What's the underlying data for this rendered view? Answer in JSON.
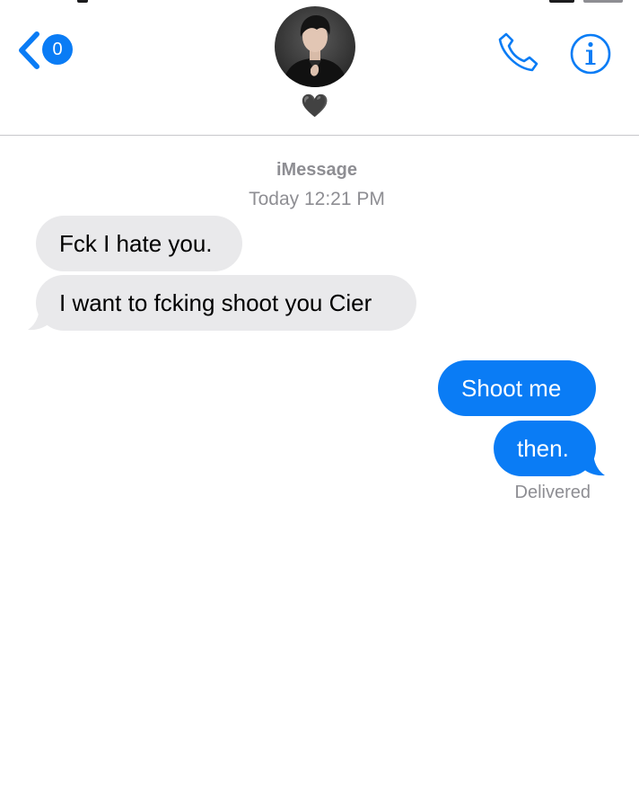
{
  "header": {
    "back_badge": "0",
    "contact_name": "🖤"
  },
  "conversation": {
    "service": "iMessage",
    "timestamp": "Today 12:21 PM",
    "messages": [
      {
        "direction": "incoming",
        "text": "Fck I hate you."
      },
      {
        "direction": "incoming",
        "text": "I want to fcking shoot you Cier"
      },
      {
        "direction": "outgoing",
        "text": "Shoot me"
      },
      {
        "direction": "outgoing",
        "text": "then."
      }
    ],
    "delivery_status": "Delivered"
  },
  "colors": {
    "accent": "#0a7cf5",
    "incoming_bubble": "#e9e9eb",
    "outgoing_bubble": "#0a7cf5",
    "secondary_text": "#8e8e93"
  },
  "icons": {
    "back": "chevron-left-icon",
    "call": "phone-icon",
    "info": "info-icon"
  }
}
